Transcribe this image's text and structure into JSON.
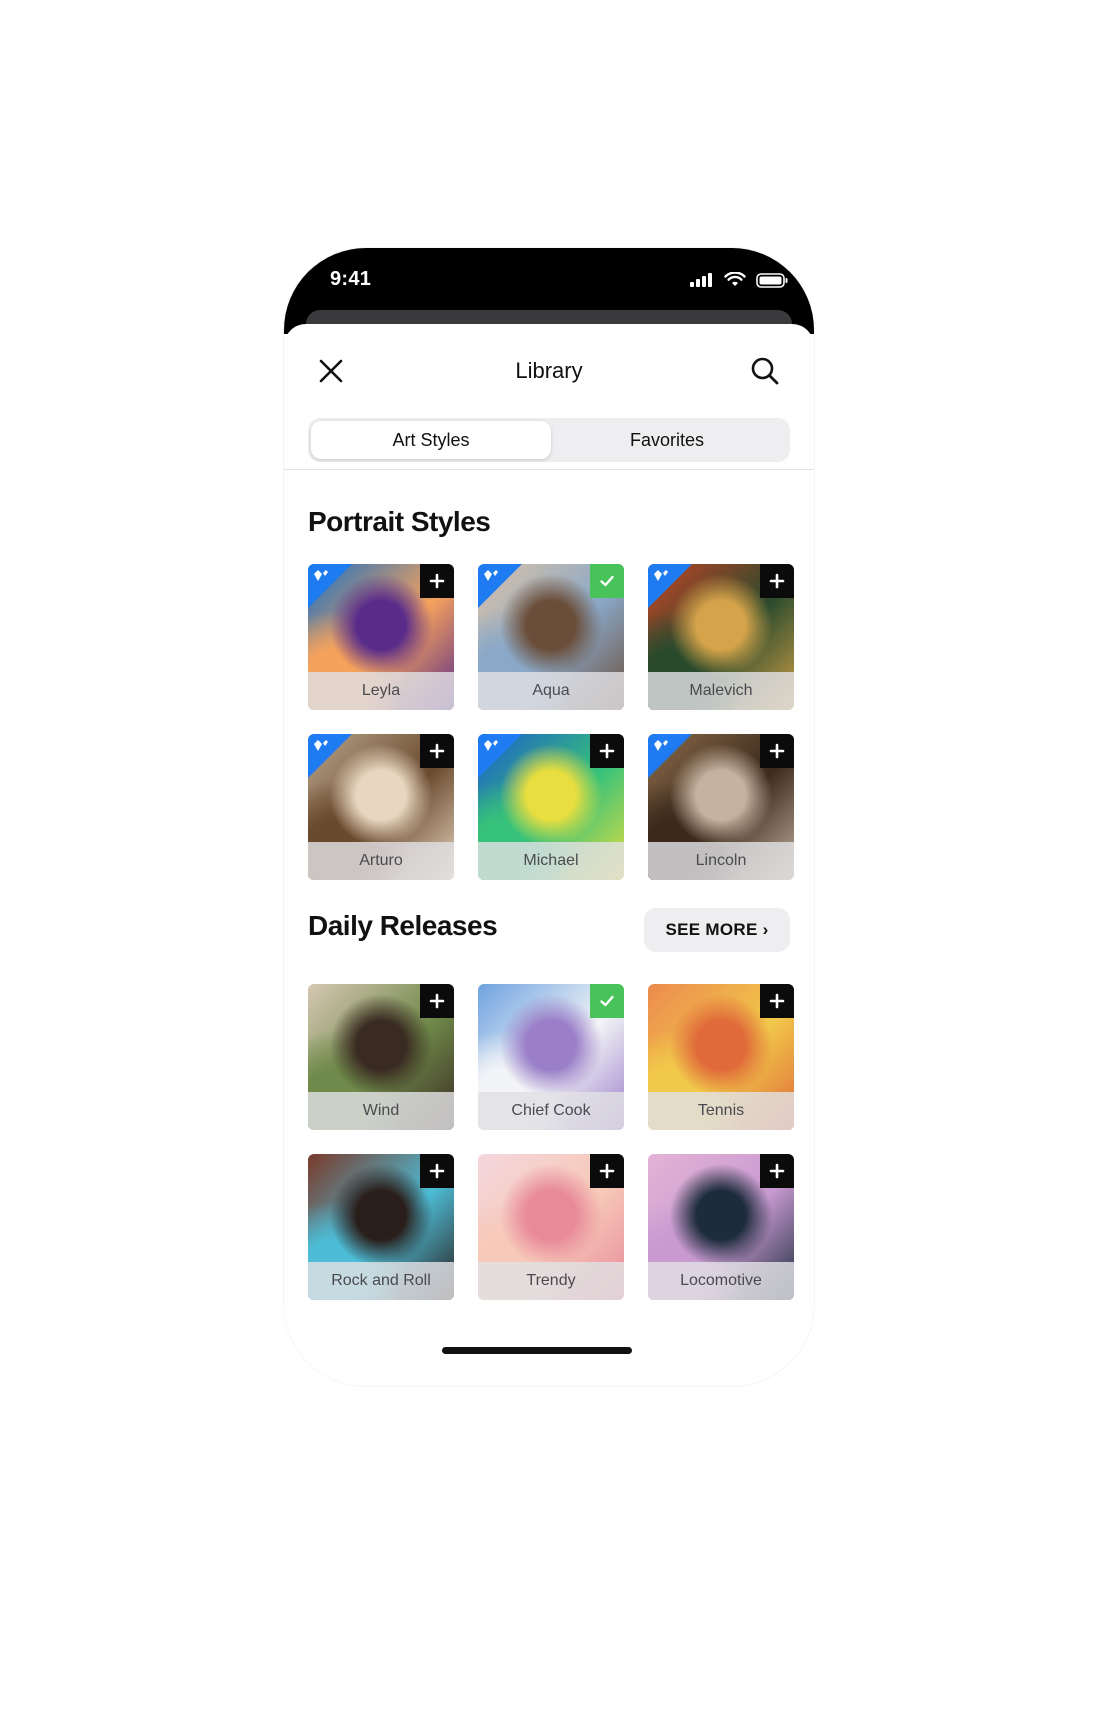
{
  "status_bar": {
    "time": "9:41"
  },
  "nav": {
    "title": "Library"
  },
  "tabs": [
    {
      "label": "Art Styles",
      "active": true
    },
    {
      "label": "Favorites",
      "active": false
    }
  ],
  "portrait": {
    "title": "Portrait Styles",
    "items": [
      {
        "label": "Leyla",
        "state": "add",
        "premium": true,
        "colors": [
          "#1b6fc2",
          "#f5a25d",
          "#5a2c8a"
        ]
      },
      {
        "label": "Aqua",
        "state": "added",
        "premium": true,
        "colors": [
          "#d9c2a6",
          "#8aa8c8",
          "#6b4e3a"
        ]
      },
      {
        "label": "Malevich",
        "state": "add",
        "premium": true,
        "colors": [
          "#c24326",
          "#2a4a2c",
          "#d4a34a"
        ]
      },
      {
        "label": "Arturo",
        "state": "add",
        "premium": true,
        "colors": [
          "#b9a58a",
          "#6a4a2e",
          "#e8d7c0"
        ]
      },
      {
        "label": "Michael",
        "state": "add",
        "premium": true,
        "colors": [
          "#1d5ec9",
          "#36c27a",
          "#e8de3f"
        ]
      },
      {
        "label": "Lincoln",
        "state": "add",
        "premium": true,
        "colors": [
          "#8a6a4a",
          "#3b2a1c",
          "#c4b3a0"
        ]
      }
    ]
  },
  "daily": {
    "title": "Daily Releases",
    "see_more": "SEE MORE ›",
    "items": [
      {
        "label": "Wind",
        "state": "add",
        "colors": [
          "#d6c7b3",
          "#6f8a4a",
          "#3a2b22"
        ]
      },
      {
        "label": "Chief Cook",
        "state": "added",
        "colors": [
          "#6ea3df",
          "#f2f4f7",
          "#9a7ec8"
        ]
      },
      {
        "label": "Tennis",
        "state": "add",
        "colors": [
          "#ec8a4e",
          "#f1c94a",
          "#e06a3a"
        ]
      },
      {
        "label": "Rock and Roll",
        "state": "add",
        "colors": [
          "#7a3a2a",
          "#4dbcd6",
          "#2a1e1a"
        ]
      },
      {
        "label": "Trendy",
        "state": "add",
        "colors": [
          "#f4d6dc",
          "#f7c9b8",
          "#e88a9a"
        ]
      },
      {
        "label": "Locomotive",
        "state": "add",
        "colors": [
          "#e3b3d6",
          "#c99ad1",
          "#1d2c3d"
        ]
      }
    ],
    "peek_colors": [
      "#e2b22a",
      "#c9943a",
      "#d9c3e9"
    ]
  },
  "icons": {
    "close": "close-icon",
    "search": "search-icon",
    "add": "plus-icon",
    "added": "checkmark-icon",
    "premium": "diamond-icon"
  }
}
